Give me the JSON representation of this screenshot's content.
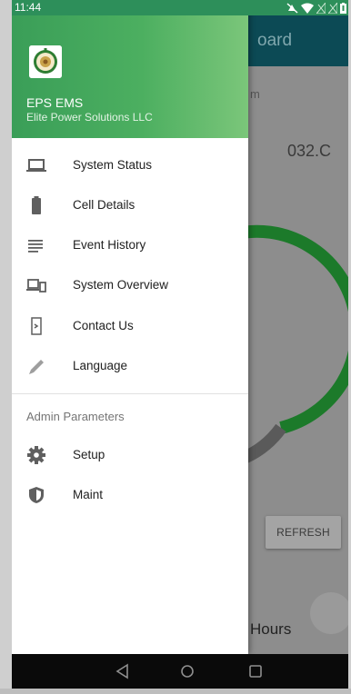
{
  "status_bar": {
    "time": "11:44"
  },
  "background_app": {
    "title_fragment": "oard",
    "subtitle_fragment": "m",
    "temperature_fragment": "032.C",
    "refresh_label": "REFRESH",
    "hours_fragment": "Hours",
    "gauge_color": "#1f8f2c"
  },
  "drawer": {
    "app_name": "EPS EMS",
    "company": "Elite Power Solutions LLC",
    "header_color": "#4caf60",
    "items": [
      {
        "label": "System Status",
        "icon": "laptop-icon"
      },
      {
        "label": "Cell Details",
        "icon": "battery-icon"
      },
      {
        "label": "Event History",
        "icon": "list-icon"
      },
      {
        "label": "System Overview",
        "icon": "devices-icon"
      },
      {
        "label": "Contact Us",
        "icon": "contact-icon"
      },
      {
        "label": "Language",
        "icon": "pen-icon"
      }
    ],
    "section_label": "Admin Parameters",
    "admin_items": [
      {
        "label": "Setup",
        "icon": "gear-icon"
      },
      {
        "label": "Maint",
        "icon": "shield-icon"
      }
    ]
  },
  "navigation_bar": {
    "buttons": [
      "back-icon",
      "home-icon",
      "recents-icon"
    ]
  }
}
